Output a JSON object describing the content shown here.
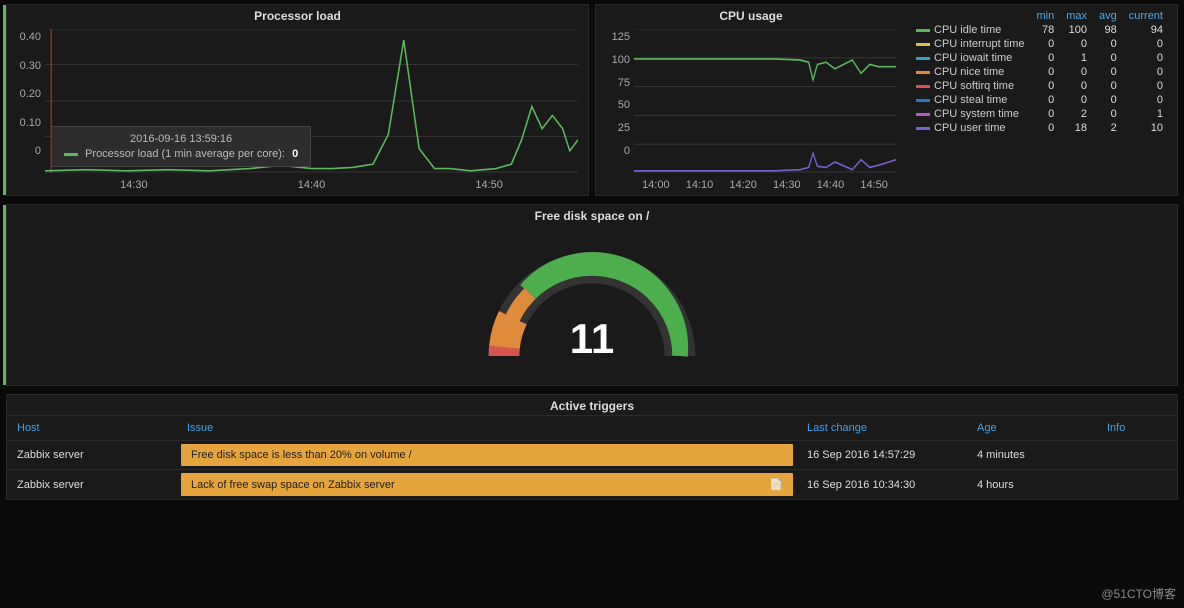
{
  "watermark": "@51CTO博客",
  "processor": {
    "title": "Processor load",
    "y_ticks": [
      "0.40",
      "0.30",
      "0.20",
      "0.10",
      "0"
    ],
    "x_ticks": [
      "14:30",
      "14:40",
      "14:50"
    ],
    "tooltip_ts": "2016-09-16 13:59:16",
    "tooltip_series": "Processor load (1 min average per core):",
    "tooltip_value": "0"
  },
  "cpu": {
    "title": "CPU usage",
    "y_ticks": [
      "125",
      "100",
      "75",
      "50",
      "25",
      "0"
    ],
    "x_ticks": [
      "14:00",
      "14:10",
      "14:20",
      "14:30",
      "14:40",
      "14:50"
    ],
    "headers": [
      "min",
      "max",
      "avg",
      "current"
    ],
    "series": [
      {
        "name": "CPU idle time",
        "color": "#5cb85c",
        "min": 78,
        "max": 100,
        "avg": 98,
        "current": 94
      },
      {
        "name": "CPU interrupt time",
        "color": "#d9c24a",
        "min": 0,
        "max": 0,
        "avg": 0,
        "current": 0
      },
      {
        "name": "CPU iowait time",
        "color": "#39a0c4",
        "min": 0,
        "max": 1,
        "avg": 0,
        "current": 0
      },
      {
        "name": "CPU nice time",
        "color": "#e08a3c",
        "min": 0,
        "max": 0,
        "avg": 0,
        "current": 0
      },
      {
        "name": "CPU softirq time",
        "color": "#d9534f",
        "min": 0,
        "max": 0,
        "avg": 0,
        "current": 0
      },
      {
        "name": "CPU steal time",
        "color": "#2d74c4",
        "min": 0,
        "max": 0,
        "avg": 0,
        "current": 0
      },
      {
        "name": "CPU system time",
        "color": "#b25bc4",
        "min": 0,
        "max": 2,
        "avg": 0,
        "current": 1
      },
      {
        "name": "CPU user time",
        "color": "#7a5fd0",
        "min": 0,
        "max": 18,
        "avg": 2,
        "current": 10
      }
    ]
  },
  "gauge": {
    "title": "Free disk space on /",
    "value": "11"
  },
  "triggers": {
    "title": "Active triggers",
    "headers": {
      "host": "Host",
      "issue": "Issue",
      "last_change": "Last change",
      "age": "Age",
      "info": "Info"
    },
    "rows": [
      {
        "host": "Zabbix server",
        "issue": "Free disk space is less than 20% on volume /",
        "last_change": "16 Sep 2016 14:57:29",
        "age": "4 minutes",
        "has_doc": false
      },
      {
        "host": "Zabbix server",
        "issue": "Lack of free swap space on Zabbix server",
        "last_change": "16 Sep 2016 10:34:30",
        "age": "4 hours",
        "has_doc": true
      }
    ]
  },
  "chart_data": [
    {
      "type": "line",
      "title": "Processor load",
      "ylabel": "",
      "xlabel": "time",
      "ylim": [
        0,
        0.4
      ],
      "x": [
        "13:59",
        "14:05",
        "14:10",
        "14:15",
        "14:20",
        "14:25",
        "14:27",
        "14:29",
        "14:31",
        "14:33",
        "14:35",
        "14:36",
        "14:37",
        "14:38",
        "14:39",
        "14:40",
        "14:42",
        "14:45",
        "14:47",
        "14:48",
        "14:49",
        "14:50",
        "14:51",
        "14:52",
        "14:53",
        "14:54"
      ],
      "series": [
        {
          "name": "Processor load (1 min average per core)",
          "color": "#5cb85c",
          "values": [
            0,
            0.01,
            0,
            0.01,
            0,
            0.02,
            0.04,
            0.02,
            0.02,
            0.03,
            0.05,
            0.15,
            0.38,
            0.1,
            0.02,
            0.02,
            0.01,
            0.02,
            0.05,
            0.12,
            0.2,
            0.14,
            0.18,
            0.14,
            0.07,
            0.1
          ]
        }
      ]
    },
    {
      "type": "line",
      "title": "CPU usage",
      "ylabel": "%",
      "xlabel": "time",
      "ylim": [
        0,
        125
      ],
      "x": [
        "14:00",
        "14:05",
        "14:10",
        "14:15",
        "14:20",
        "14:25",
        "14:30",
        "14:32",
        "14:34",
        "14:35",
        "14:36",
        "14:38",
        "14:40",
        "14:45",
        "14:48",
        "14:50",
        "14:52",
        "14:54"
      ],
      "series": [
        {
          "name": "CPU idle time",
          "color": "#5cb85c",
          "values": [
            99,
            99,
            99,
            99,
            99,
            99,
            99,
            98,
            96,
            82,
            94,
            96,
            92,
            98,
            90,
            96,
            94,
            94
          ]
        },
        {
          "name": "CPU interrupt time",
          "color": "#d9c24a",
          "values": [
            0,
            0,
            0,
            0,
            0,
            0,
            0,
            0,
            0,
            0,
            0,
            0,
            0,
            0,
            0,
            0,
            0,
            0
          ]
        },
        {
          "name": "CPU iowait time",
          "color": "#39a0c4",
          "values": [
            0,
            0,
            0,
            0,
            0,
            0,
            0,
            0,
            0,
            1,
            0,
            0,
            0,
            0,
            0,
            0,
            0,
            0
          ]
        },
        {
          "name": "CPU nice time",
          "color": "#e08a3c",
          "values": [
            0,
            0,
            0,
            0,
            0,
            0,
            0,
            0,
            0,
            0,
            0,
            0,
            0,
            0,
            0,
            0,
            0,
            0
          ]
        },
        {
          "name": "CPU softirq time",
          "color": "#d9534f",
          "values": [
            0,
            0,
            0,
            0,
            0,
            0,
            0,
            0,
            0,
            0,
            0,
            0,
            0,
            0,
            0,
            0,
            0,
            0
          ]
        },
        {
          "name": "CPU steal time",
          "color": "#2d74c4",
          "values": [
            0,
            0,
            0,
            0,
            0,
            0,
            0,
            0,
            0,
            0,
            0,
            0,
            0,
            0,
            0,
            0,
            0,
            0
          ]
        },
        {
          "name": "CPU system time",
          "color": "#b25bc4",
          "values": [
            0,
            0,
            0,
            0,
            0,
            0,
            0,
            1,
            1,
            2,
            1,
            1,
            1,
            0,
            1,
            1,
            1,
            1
          ]
        },
        {
          "name": "CPU user time",
          "color": "#7a5fd0",
          "values": [
            1,
            1,
            1,
            1,
            1,
            1,
            1,
            2,
            4,
            16,
            5,
            4,
            8,
            2,
            9,
            4,
            6,
            10
          ]
        }
      ]
    },
    {
      "type": "gauge",
      "title": "Free disk space on /",
      "value": 11,
      "min": 0,
      "max": 100,
      "thresholds": [
        {
          "from": 0,
          "to": 10,
          "color": "#d9534f"
        },
        {
          "from": 10,
          "to": 25,
          "color": "#e08a3c"
        },
        {
          "from": 25,
          "to": 100,
          "color": "#5cb85c"
        }
      ]
    }
  ]
}
